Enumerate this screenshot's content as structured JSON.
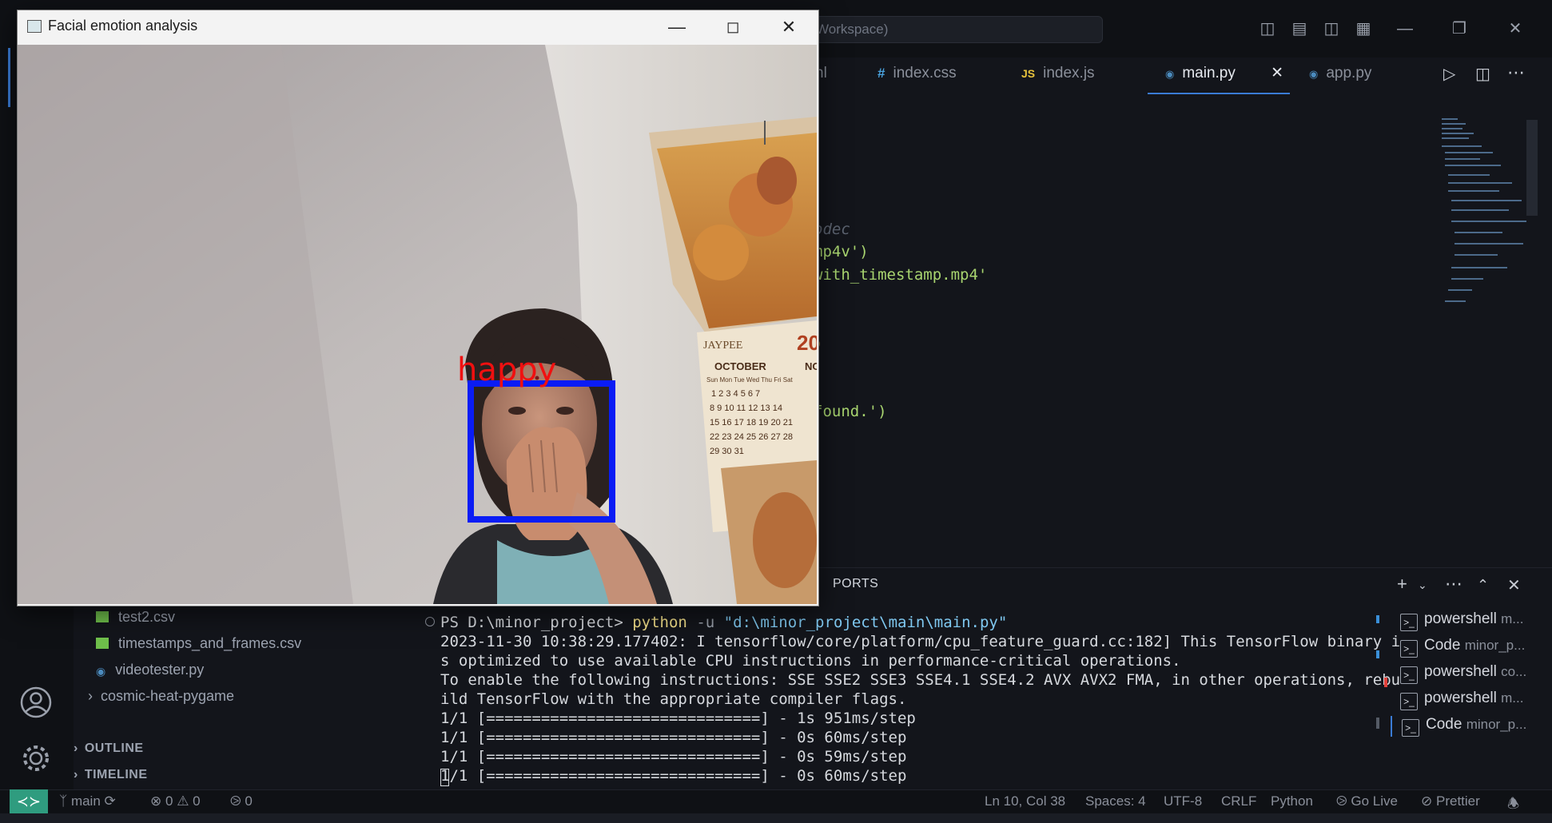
{
  "vscode": {
    "command_center": "Workspace)",
    "tabs": [
      {
        "label": "nl",
        "icon": ""
      },
      {
        "label": "index.css",
        "icon": "#"
      },
      {
        "label": "index.js",
        "icon": "JS"
      },
      {
        "label": "main.py",
        "icon": "py"
      },
      {
        "label": "app.py",
        "icon": "py"
      }
    ],
    "tab_close": "✕",
    "code_lines": [
      {
        "text": "odec",
        "kind": "comment"
      },
      {
        "text": "mp4v')",
        "kind": "string"
      },
      {
        "text": "with_timestamp.mp4'",
        "kind": "string"
      },
      {
        "text": ")",
        "kind": "bracket"
      },
      {
        "text": "found.')",
        "kind": "string"
      }
    ],
    "panel": {
      "active_tab": "PORTS"
    },
    "terminal": {
      "prompt": "PS D:\\minor_project>",
      "command": "python",
      "flag": "-u",
      "arg": "\"d:\\minor_project\\main\\main.py\"",
      "lines": [
        "2023-11-30 10:38:29.177402: I tensorflow/core/platform/cpu_feature_guard.cc:182] This TensorFlow binary i",
        "s optimized to use available CPU instructions in performance-critical operations.",
        "To enable the following instructions: SSE SSE2 SSE3 SSE4.1 SSE4.2 AVX AVX2 FMA, in other operations, rebu",
        "ild TensorFlow with the appropriate compiler flags.",
        "1/1 [==============================] - 1s 951ms/step",
        "1/1 [==============================] - 0s 60ms/step",
        "1/1 [==============================] - 0s 59ms/step",
        "1/1 [==============================] - 0s 60ms/step"
      ]
    },
    "terminal_list": [
      {
        "name": "powershell",
        "sub": "m..."
      },
      {
        "name": "Code",
        "sub": "minor_p..."
      },
      {
        "name": "powershell",
        "sub": "co..."
      },
      {
        "name": "powershell",
        "sub": "m..."
      },
      {
        "name": "Code",
        "sub": "minor_p..."
      }
    ],
    "explorer": {
      "files": [
        {
          "name": "test2.csv",
          "type": "csv"
        },
        {
          "name": "timestamps_and_frames.csv",
          "type": "csv"
        },
        {
          "name": "videotester.py",
          "type": "py"
        },
        {
          "name": "cosmic-heat-pygame",
          "type": "folder"
        }
      ],
      "outline": "OUTLINE",
      "timeline": "TIMELINE"
    },
    "statusbar": {
      "branch": "main",
      "errors": "0",
      "warnings": "0",
      "ports": "0",
      "position": "Ln 10, Col 38",
      "spaces": "Spaces: 4",
      "encoding": "UTF-8",
      "eol": "CRLF",
      "language": "Python",
      "golive": "Go Live",
      "prettier": "Prettier"
    }
  },
  "cv_window": {
    "title": "Facial emotion analysis",
    "emotion_label": "happy",
    "calendar_month": "OCTOBER",
    "calendar_brand": "JAYPEE",
    "calendar_year": "20",
    "calendar_next": "NO",
    "calendar_days": "Sun Mon Tue Wed Thu Fri Sat",
    "calendar_rows": [
      "1 2 3 4 5 6 7",
      "8 9 10 11 12 13 14",
      "15 16 17 18 19 20 21",
      "22 23 24 25 26 27 28",
      "29 30 31"
    ]
  }
}
